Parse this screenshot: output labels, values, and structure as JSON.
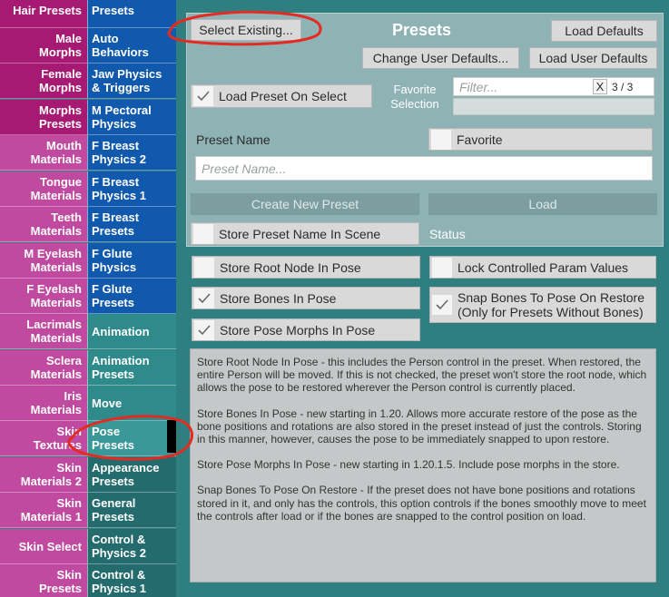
{
  "left_column": [
    "Hair Presets",
    "Male\nMorphs",
    "Female\nMorphs",
    "Morphs\nPresets",
    "Mouth\nMaterials",
    "Tongue\nMaterials",
    "Teeth\nMaterials",
    "M Eyelash\nMaterials",
    "F Eyelash\nMaterials",
    "Lacrimals\nMaterials",
    "Sclera\nMaterials",
    "Iris\nMaterials",
    "Skin\nTextures",
    "Skin\nMaterials 2",
    "Skin\nMaterials 1",
    "Skin Select",
    "Skin\nPresets"
  ],
  "middle_column": [
    "Presets",
    "Auto\nBehaviors",
    "Jaw Physics\n& Triggers",
    "M Pectoral\nPhysics",
    "F Breast\nPhysics 2",
    "F Breast\nPhysics 1",
    "F Breast\nPresets",
    "F Glute\nPhysics",
    "F Glute\nPresets",
    "Animation",
    "Animation\nPresets",
    "Move",
    "Pose\nPresets",
    "Appearance\nPresets",
    "General\nPresets",
    "Control &\nPhysics 2",
    "Control &\nPhysics 1"
  ],
  "panel": {
    "title": "Presets",
    "select_existing": "Select Existing...",
    "load_defaults": "Load Defaults",
    "change_user_defaults": "Change User Defaults...",
    "load_user_defaults": "Load User Defaults",
    "load_preset_on_select": "Load Preset On Select",
    "favorite_selection": "Favorite\nSelection",
    "filter_placeholder": "Filter...",
    "filter_clear": "X",
    "filter_count": "3 / 3",
    "preset_name_label": "Preset Name",
    "favorite": "Favorite",
    "preset_name_placeholder": "Preset Name...",
    "create_new_preset": "Create New Preset",
    "load": "Load",
    "store_preset_name": "Store Preset Name In Scene",
    "status": "Status"
  },
  "options": {
    "store_root_node": "Store Root Node In Pose",
    "lock_controlled": "Lock Controlled Param Values",
    "store_bones": "Store Bones In Pose",
    "snap_bones": "Snap Bones To Pose On Restore\n(Only for Presets Without Bones)",
    "store_pose_morphs": "Store Pose Morphs In Pose"
  },
  "help_text": [
    "Store Root Node In Pose - this includes the Person control in the preset. When restored, the entire Person will be moved. If this is not checked, the preset won't store the root node, which allows the pose to be restored wherever the Person control is currently placed.",
    "Store Bones In Pose - new starting in 1.20. Allows more accurate restore of the pose as the bone positions and rotations are also stored in the preset instead of just the controls. Storing in this manner, however, causes the pose to be immediately snapped to upon restore.",
    "Store Pose Morphs In Pose - new starting in 1.20.1.5. Include pose morphs in the store.",
    "Snap Bones To Pose On Restore - If the preset does not have bone positions and rotations stored in it, and only has the controls, this option controls if the bones smoothly move to meet the controls after load or if the bones are snapped to the control position on load."
  ],
  "colors": {
    "left_magenta": "#a71a73",
    "left_pink": "#c04aa0",
    "mid_blue": "#1059ad",
    "mid_teal": "#2f8a8c",
    "panel_bg": "#8fb3b5",
    "annotation_red": "#e32b22"
  }
}
